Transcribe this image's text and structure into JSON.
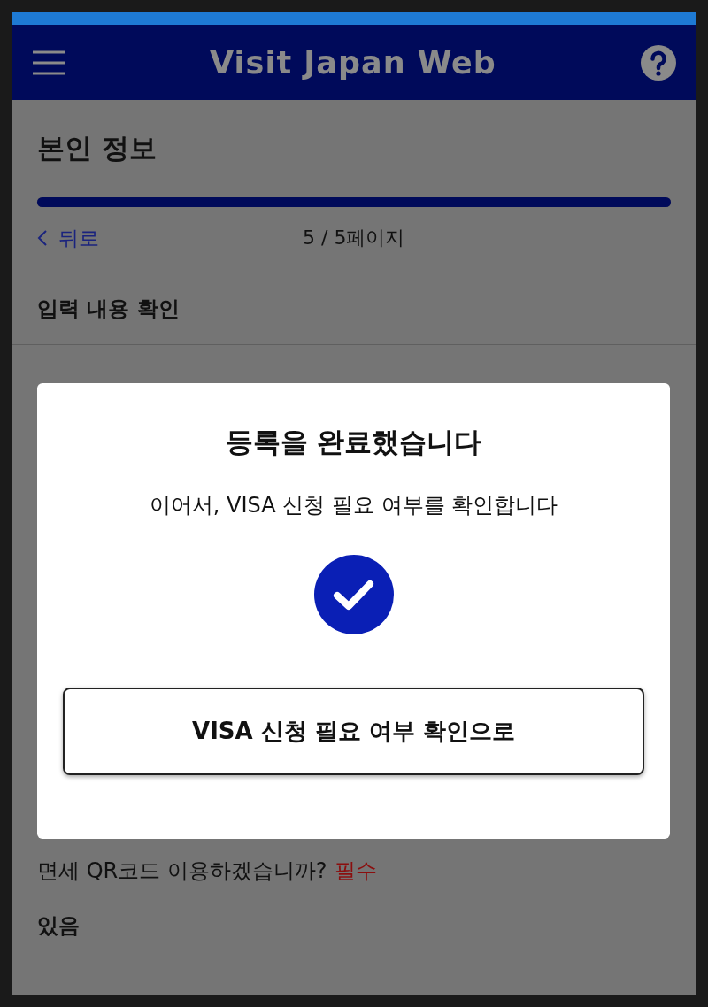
{
  "header": {
    "title": "Visit Japan Web"
  },
  "page": {
    "title": "본인 정보",
    "progress": {
      "level": 1
    },
    "back": "뒤로",
    "page_indicator": "5 / 5페이지"
  },
  "section": {
    "title": "입력 내용 확인"
  },
  "question": {
    "label": "면세 QR코드 이용하겠습니까?",
    "required_tag": "필수",
    "answer": "있음"
  },
  "dialog": {
    "title": "등록을 완료했습니다",
    "message": "이어서, VISA 신청 필요 여부를 확인합니다",
    "button": "VISA 신청 필요 여부 확인으로"
  }
}
